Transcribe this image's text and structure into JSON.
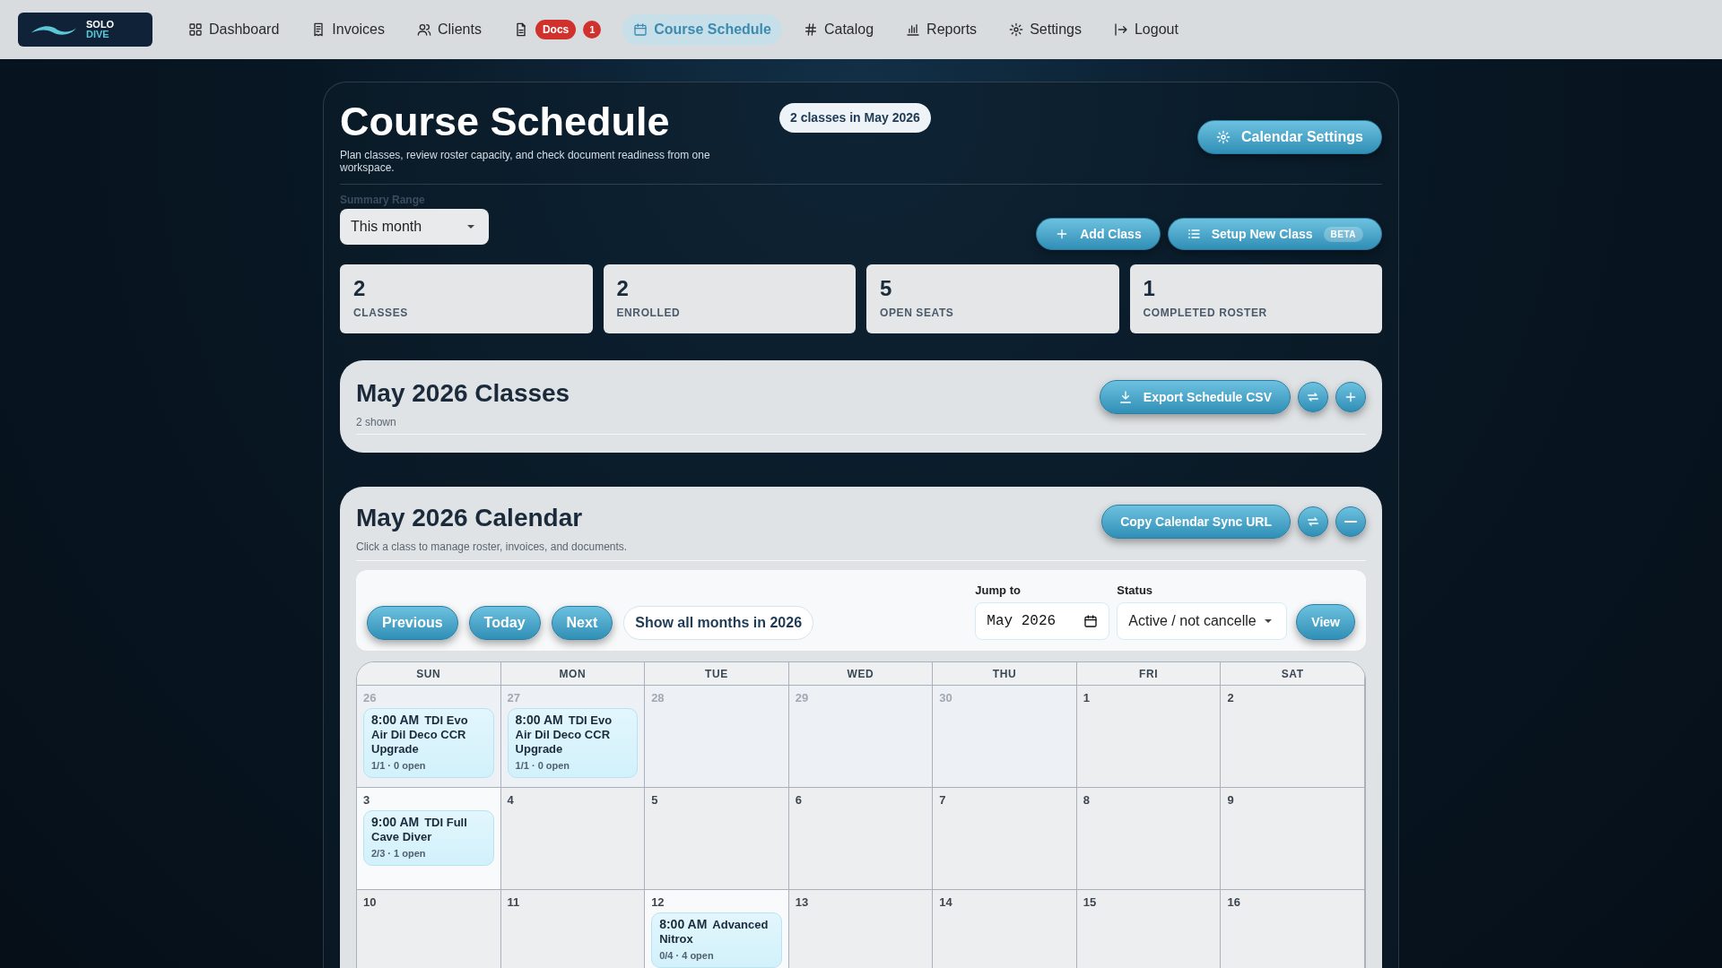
{
  "nav": {
    "logo": {
      "line1": "SOLO",
      "line2": "DIVE"
    },
    "items": [
      {
        "kind": "dashboard",
        "label": "Dashboard",
        "selected": false
      },
      {
        "kind": "invoices",
        "label": "Invoices",
        "selected": false
      },
      {
        "kind": "clients",
        "label": "Clients",
        "selected": false
      },
      {
        "kind": "docs",
        "label": "Docs",
        "count": "1",
        "selected": false
      },
      {
        "kind": "schedule",
        "label": "Course Schedule",
        "selected": true
      },
      {
        "kind": "catalog",
        "label": "Catalog",
        "selected": false
      },
      {
        "kind": "reports",
        "label": "Reports",
        "selected": false
      },
      {
        "kind": "settings",
        "label": "Settings",
        "selected": false
      },
      {
        "kind": "logout",
        "label": "Logout",
        "selected": false
      }
    ]
  },
  "header": {
    "title": "Course Schedule",
    "subtitle": "Plan classes, review roster capacity, and check document readiness from one workspace.",
    "badge": "2 classes in May 2026",
    "settings_button": "Calendar Settings"
  },
  "summary_range": {
    "label": "Summary Range",
    "value": "This month"
  },
  "actions": [
    {
      "kind": "add",
      "label": "Add Class"
    },
    {
      "kind": "setup",
      "label": "Setup New Class",
      "tag": "BETA"
    }
  ],
  "stats": [
    {
      "value": "2",
      "label": "CLASSES"
    },
    {
      "value": "2",
      "label": "ENROLLED"
    },
    {
      "value": "5",
      "label": "OPEN SEATS"
    },
    {
      "value": "1",
      "label": "COMPLETED ROSTER"
    }
  ],
  "classes_panel": {
    "title": "May 2026 Classes",
    "subtitle": "2 shown",
    "export_button": "Export Schedule CSV",
    "expanded": false
  },
  "calendar_panel": {
    "title": "May 2026 Calendar",
    "subtitle": "Click a class to manage roster, invoices, and documents.",
    "sync_button": "Copy Calendar Sync URL",
    "expanded": true,
    "nav_buttons": [
      "Previous",
      "Today",
      "Next"
    ],
    "show_all": "Show all months in 2026",
    "jump_to": {
      "label": "Jump to",
      "value": "May 2026"
    },
    "status": {
      "label": "Status",
      "value": "Active / not cancelle"
    },
    "view_button": "View",
    "weekdays": [
      "SUN",
      "MON",
      "TUE",
      "WED",
      "THU",
      "FRI",
      "SAT"
    ],
    "weeks": [
      [
        {
          "day": "26",
          "outside": true,
          "highlighted": false,
          "events": [
            {
              "time": "8:00 AM",
              "title": "TDI Evo Air Dil Deco CCR Upgrade",
              "meta": "1/1 · 0 open"
            }
          ]
        },
        {
          "day": "27",
          "outside": true,
          "highlighted": false,
          "events": [
            {
              "time": "8:00 AM",
              "title": "TDI Evo Air Dil Deco CCR Upgrade",
              "meta": "1/1 · 0 open"
            }
          ]
        },
        {
          "day": "28",
          "outside": true,
          "highlighted": false
        },
        {
          "day": "29",
          "outside": true,
          "highlighted": false
        },
        {
          "day": "30",
          "outside": true,
          "highlighted": false
        },
        {
          "day": "1",
          "outside": false,
          "highlighted": false
        },
        {
          "day": "2",
          "outside": false,
          "highlighted": false
        }
      ],
      [
        {
          "day": "3",
          "outside": false,
          "highlighted": true,
          "events": [
            {
              "time": "9:00 AM",
              "title": "TDI Full Cave Diver",
              "meta": "2/3 · 1 open"
            }
          ]
        },
        {
          "day": "4",
          "outside": false,
          "highlighted": false
        },
        {
          "day": "5",
          "outside": false,
          "highlighted": false
        },
        {
          "day": "6",
          "outside": false,
          "highlighted": false
        },
        {
          "day": "7",
          "outside": false,
          "highlighted": false
        },
        {
          "day": "8",
          "outside": false,
          "highlighted": false
        },
        {
          "day": "9",
          "outside": false,
          "highlighted": false
        }
      ],
      [
        {
          "day": "10",
          "outside": false,
          "highlighted": false
        },
        {
          "day": "11",
          "outside": false,
          "highlighted": false
        },
        {
          "day": "12",
          "outside": false,
          "highlighted": true,
          "events": [
            {
              "time": "8:00 AM",
              "title": "Advanced Nitrox",
              "meta": "0/4 · 4 open"
            }
          ]
        },
        {
          "day": "13",
          "outside": false,
          "highlighted": false
        },
        {
          "day": "14",
          "outside": false,
          "highlighted": false
        },
        {
          "day": "15",
          "outside": false,
          "highlighted": false
        },
        {
          "day": "16",
          "outside": false,
          "highlighted": false
        }
      ]
    ]
  }
}
